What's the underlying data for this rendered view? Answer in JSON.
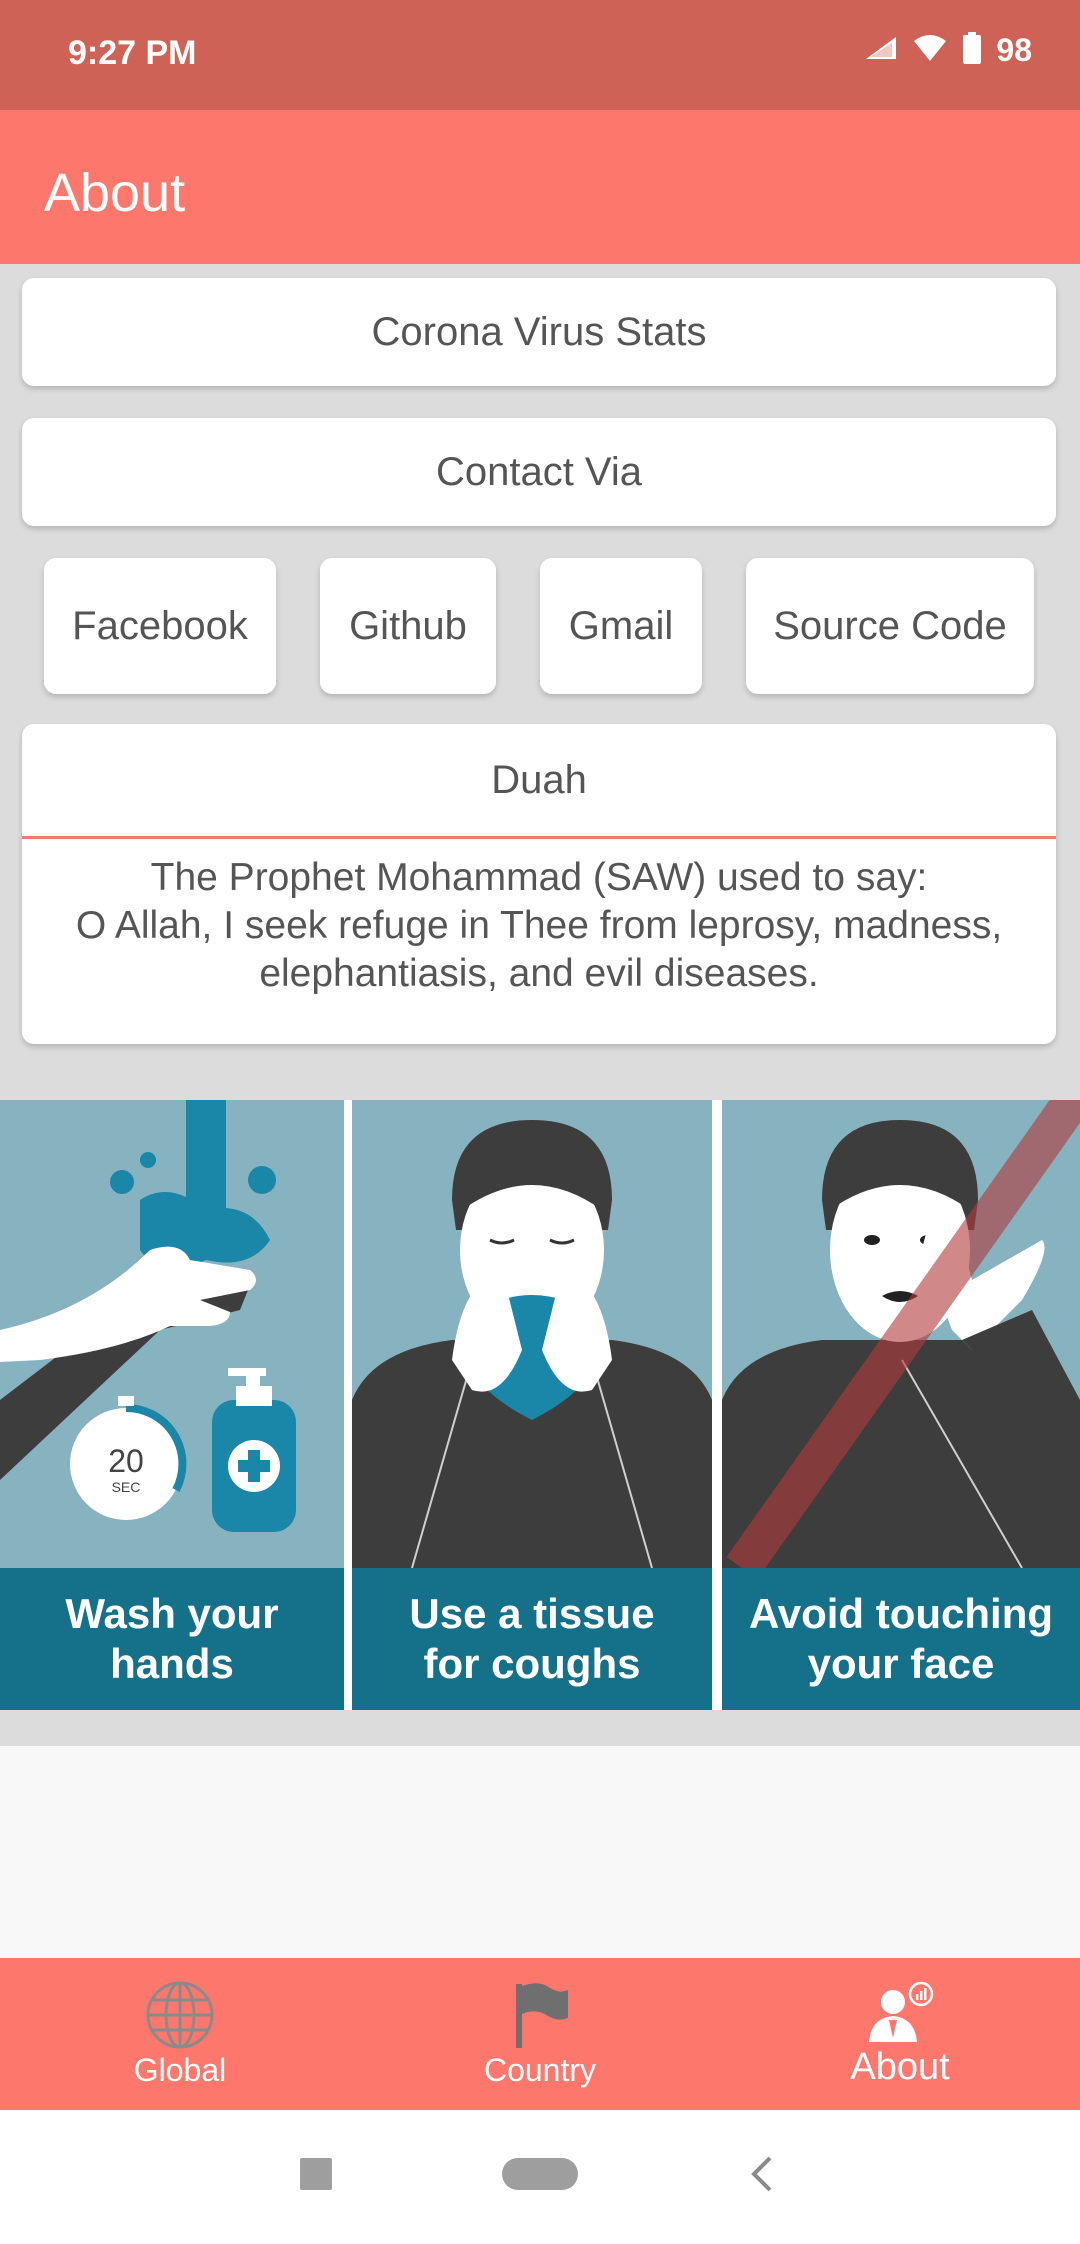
{
  "status_bar": {
    "time": "9:27 PM",
    "battery_level": "98",
    "icons": [
      "signal-icon",
      "wifi-icon",
      "battery-icon"
    ]
  },
  "app_bar": {
    "title": "About"
  },
  "cards": {
    "stats_label": "Corona Virus Stats",
    "contact_label": "Contact Via"
  },
  "contact_buttons": [
    {
      "label": "Facebook"
    },
    {
      "label": "Github"
    },
    {
      "label": "Gmail"
    },
    {
      "label": "Source Code"
    }
  ],
  "duah": {
    "title": "Duah",
    "line1": "The Prophet Mohammad (SAW) used to say:",
    "line2": "O Allah, I seek refuge in Thee from leprosy, madness, elephantiasis, and evil diseases."
  },
  "poster": {
    "panels": [
      {
        "label": "Wash your\nhands",
        "timer_value": "20",
        "timer_unit": "SEC"
      },
      {
        "label": "Use a tissue\nfor coughs"
      },
      {
        "label": "Avoid touching\nyour face"
      }
    ]
  },
  "bottom_nav": {
    "items": [
      {
        "label": "Global",
        "icon": "globe-icon"
      },
      {
        "label": "Country",
        "icon": "flag-icon"
      },
      {
        "label": "About",
        "icon": "about-user-icon"
      }
    ],
    "active_index": 2
  },
  "colors": {
    "status_bar": "#cf6257",
    "accent": "#fd776d",
    "poster_banner": "#157089",
    "poster_bg": "#87b2c0"
  }
}
